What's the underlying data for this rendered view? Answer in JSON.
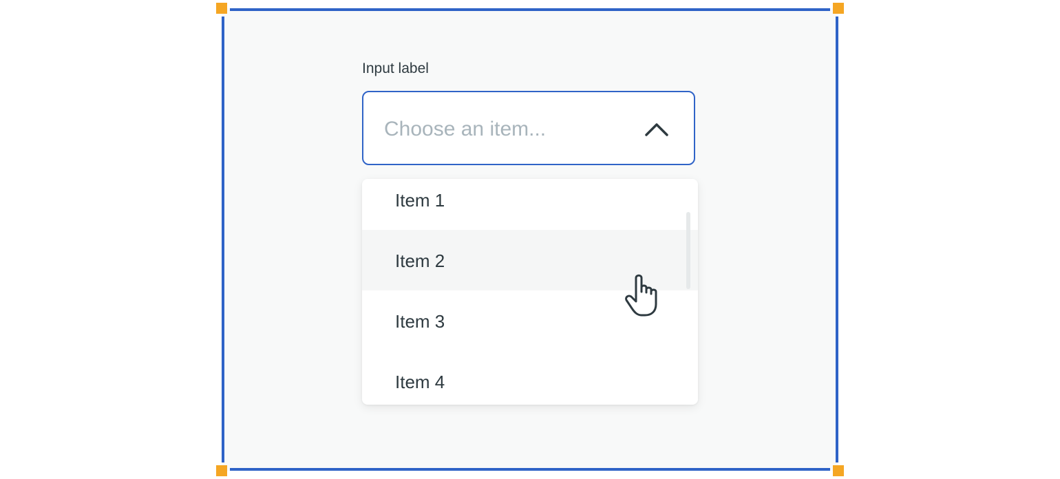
{
  "field": {
    "label": "Input label",
    "placeholder": "Choose an item..."
  },
  "dropdown": {
    "options": [
      {
        "label": "Item 1"
      },
      {
        "label": "Item 2"
      },
      {
        "label": "Item 3"
      },
      {
        "label": "Item 4"
      }
    ],
    "hovered_item": "Item 2"
  },
  "icons": {
    "chevron": "chevron-up-icon",
    "cursor": "hand-pointer-cursor-icon"
  },
  "colors": {
    "focus_border": "#2f63c7",
    "selection_handle": "#f5a623",
    "placeholder_text": "#a8b4bb",
    "text": "#2e3a40",
    "hover_background": "#f5f6f6"
  }
}
